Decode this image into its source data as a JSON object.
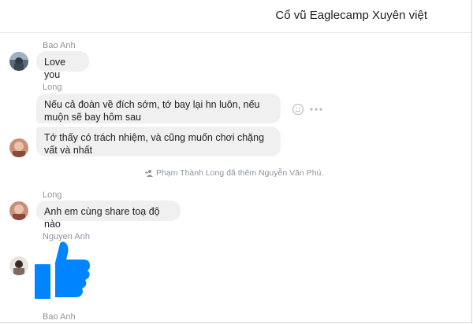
{
  "conversation": {
    "title": "Cổ vũ Eaglecamp Xuyên việt"
  },
  "messages": [
    {
      "sender": "Bao Anh",
      "text": "Love you"
    },
    {
      "sender": "Long",
      "texts": [
        "Nếu cả đoàn về đích sớm, tớ bay lại hn luôn, nếu muộn sẽ bay hôm sau",
        "Tớ thấy có trách nhiệm, và cũng muốn chơi chặng vất và nhất"
      ]
    },
    {
      "system": "Phạm Thành Long đã thêm Nguyễn Văn Phú."
    },
    {
      "sender": "Long",
      "text": "Anh em cùng share toạ độ nào"
    },
    {
      "sender": "Nguyen Anh",
      "sticker": "thumbs-up"
    },
    {
      "sender": "Bao Anh"
    }
  ],
  "icons": {
    "react": "smiley-icon",
    "more": "more-icon",
    "added": "add-person-icon",
    "thumbs": "thumbs-up-icon"
  },
  "colors": {
    "thumb": "#0084ff",
    "bubble": "#f1f0f0",
    "meta": "#8d949e"
  }
}
